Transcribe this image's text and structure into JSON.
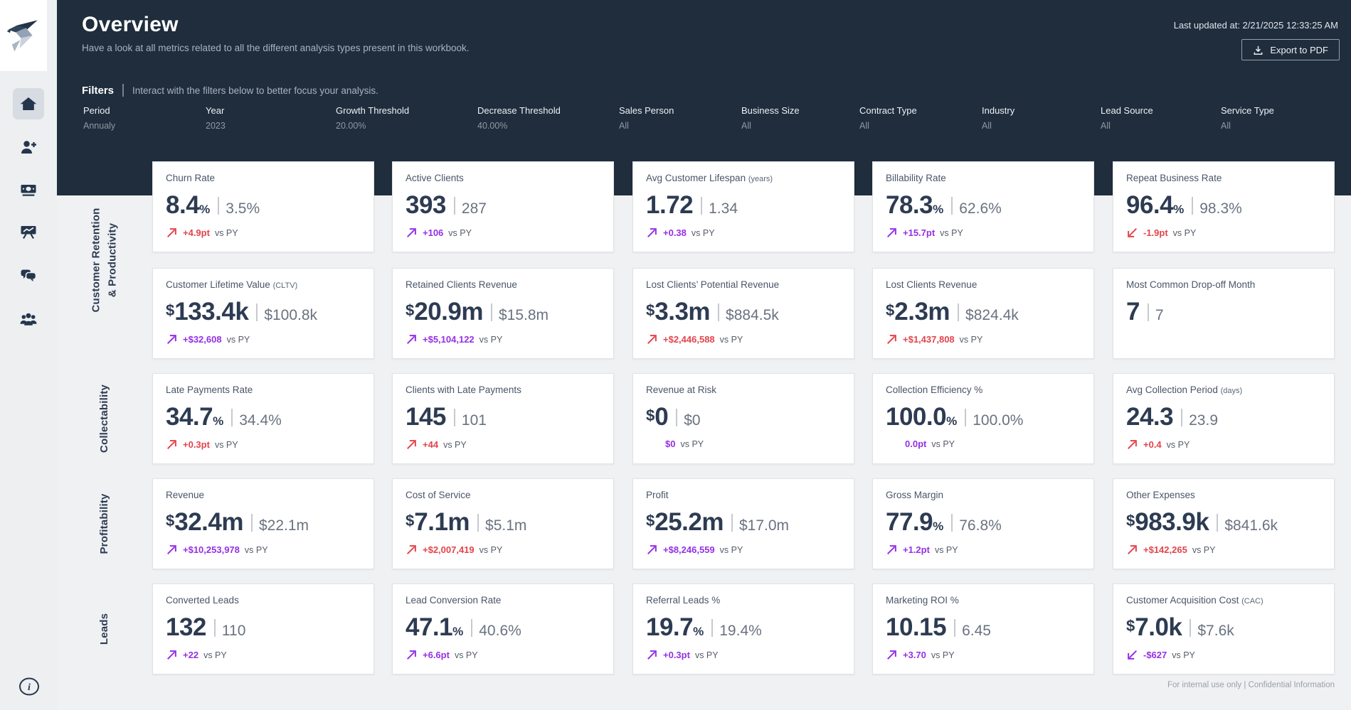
{
  "header": {
    "title": "Overview",
    "subtitle": "Have a look at all metrics related to all the different analysis types present in this workbook.",
    "last_updated": "Last updated at: 2/21/2025 12:33:25 AM",
    "export_label": "Export to PDF"
  },
  "filters": {
    "title": "Filters",
    "hint": "Interact with the filters below to better focus your analysis.",
    "items": [
      {
        "label": "Period",
        "value": "Annualy"
      },
      {
        "label": "Year",
        "value": "2023"
      },
      {
        "label": "Growth Threshold",
        "value": "20.00%"
      },
      {
        "label": "Decrease Threshold",
        "value": "40.00%"
      },
      {
        "label": "Sales Person",
        "value": "All"
      },
      {
        "label": "Business Size",
        "value": "All"
      },
      {
        "label": "Contract Type",
        "value": "All"
      },
      {
        "label": "Industry",
        "value": "All"
      },
      {
        "label": "Lead Source",
        "value": "All"
      },
      {
        "label": "Service Type",
        "value": "All"
      }
    ]
  },
  "sidebar": {
    "icons": [
      "home-icon",
      "person-add-icon",
      "cash-icon",
      "presentation-chart-icon",
      "chat-bubbles-icon",
      "people-group-icon"
    ],
    "info_icon": "info-icon",
    "logo": "bird-logo"
  },
  "colors": {
    "red": "#e2444b",
    "purple": "#9430e4",
    "header_bg": "#1f2d3c",
    "value_navy": "#2d3b52"
  },
  "vs_label": "vs PY",
  "groups": [
    {
      "label_lines": [
        "Customer Retention",
        "& Productivity"
      ],
      "cards": [
        {
          "title": "Churn Rate",
          "title_suffix": "",
          "prefix": "",
          "value": "8.4",
          "suffix": "%",
          "prev": "3.5%",
          "change": {
            "text": "+4.9pt",
            "direction": "up",
            "color": "red"
          }
        },
        {
          "title": "Active Clients",
          "title_suffix": "",
          "prefix": "",
          "value": "393",
          "suffix": "",
          "prev": "287",
          "change": {
            "text": "+106",
            "direction": "up",
            "color": "purple"
          }
        },
        {
          "title": "Avg Customer Lifespan",
          "title_suffix": "(years)",
          "prefix": "",
          "value": "1.72",
          "suffix": "",
          "prev": "1.34",
          "change": {
            "text": "+0.38",
            "direction": "up",
            "color": "purple"
          }
        },
        {
          "title": "Billability Rate",
          "title_suffix": "",
          "prefix": "",
          "value": "78.3",
          "suffix": "%",
          "prev": "62.6%",
          "change": {
            "text": "+15.7pt",
            "direction": "up",
            "color": "purple"
          }
        },
        {
          "title": "Repeat Business Rate",
          "title_suffix": "",
          "prefix": "",
          "value": "96.4",
          "suffix": "%",
          "prev": "98.3%",
          "change": {
            "text": "-1.9pt",
            "direction": "down",
            "color": "red"
          }
        },
        {
          "title": "Customer Lifetime Value",
          "title_suffix": "(CLTV)",
          "prefix": "$",
          "value": "133.4k",
          "suffix": "",
          "prev": "$100.8k",
          "change": {
            "text": "+$32,608",
            "direction": "up",
            "color": "purple"
          }
        },
        {
          "title": "Retained Clients Revenue",
          "title_suffix": "",
          "prefix": "$",
          "value": "20.9m",
          "suffix": "",
          "prev": "$15.8m",
          "change": {
            "text": "+$5,104,122",
            "direction": "up",
            "color": "purple"
          }
        },
        {
          "title": "Lost Clients’ Potential Revenue",
          "title_suffix": "",
          "prefix": "$",
          "value": "3.3m",
          "suffix": "",
          "prev": "$884.5k",
          "change": {
            "text": "+$2,446,588",
            "direction": "up",
            "color": "red"
          }
        },
        {
          "title": "Lost Clients Revenue",
          "title_suffix": "",
          "prefix": "$",
          "value": "2.3m",
          "suffix": "",
          "prev": "$824.4k",
          "change": {
            "text": "+$1,437,808",
            "direction": "up",
            "color": "red"
          }
        },
        {
          "title": "Most Common Drop-off Month",
          "title_suffix": "",
          "prefix": "",
          "value": "7",
          "suffix": "",
          "prev": "7",
          "change": null
        }
      ]
    },
    {
      "label_lines": [
        "Collectability"
      ],
      "cards": [
        {
          "title": "Late Payments Rate",
          "title_suffix": "",
          "prefix": "",
          "value": "34.7",
          "suffix": "%",
          "prev": "34.4%",
          "change": {
            "text": "+0.3pt",
            "direction": "up",
            "color": "red"
          }
        },
        {
          "title": "Clients with Late Payments",
          "title_suffix": "",
          "prefix": "",
          "value": "145",
          "suffix": "",
          "prev": "101",
          "change": {
            "text": "+44",
            "direction": "up",
            "color": "red"
          }
        },
        {
          "title": "Revenue at Risk",
          "title_suffix": "",
          "prefix": "$",
          "value": "0",
          "suffix": "",
          "prev": "$0",
          "change": {
            "text": "$0",
            "direction": "flat",
            "color": "purple"
          }
        },
        {
          "title": "Collection Efficiency %",
          "title_suffix": "",
          "prefix": "",
          "value": "100.0",
          "suffix": "%",
          "prev": "100.0%",
          "change": {
            "text": "0.0pt",
            "direction": "flat",
            "color": "purple"
          }
        },
        {
          "title": "Avg Collection Period",
          "title_suffix": "(days)",
          "prefix": "",
          "value": "24.3",
          "suffix": "",
          "prev": "23.9",
          "change": {
            "text": "+0.4",
            "direction": "up",
            "color": "red"
          }
        }
      ]
    },
    {
      "label_lines": [
        "Profitability"
      ],
      "cards": [
        {
          "title": "Revenue",
          "title_suffix": "",
          "prefix": "$",
          "value": "32.4m",
          "suffix": "",
          "prev": "$22.1m",
          "change": {
            "text": "+$10,253,978",
            "direction": "up",
            "color": "purple"
          }
        },
        {
          "title": "Cost of Service",
          "title_suffix": "",
          "prefix": "$",
          "value": "7.1m",
          "suffix": "",
          "prev": "$5.1m",
          "change": {
            "text": "+$2,007,419",
            "direction": "up",
            "color": "red"
          }
        },
        {
          "title": "Profit",
          "title_suffix": "",
          "prefix": "$",
          "value": "25.2m",
          "suffix": "",
          "prev": "$17.0m",
          "change": {
            "text": "+$8,246,559",
            "direction": "up",
            "color": "purple"
          }
        },
        {
          "title": "Gross Margin",
          "title_suffix": "",
          "prefix": "",
          "value": "77.9",
          "suffix": "%",
          "prev": "76.8%",
          "change": {
            "text": "+1.2pt",
            "direction": "up",
            "color": "purple"
          }
        },
        {
          "title": "Other Expenses",
          "title_suffix": "",
          "prefix": "$",
          "value": "983.9k",
          "suffix": "",
          "prev": "$841.6k",
          "change": {
            "text": "+$142,265",
            "direction": "up",
            "color": "red"
          }
        }
      ]
    },
    {
      "label_lines": [
        "Leads"
      ],
      "cards": [
        {
          "title": "Converted Leads",
          "title_suffix": "",
          "prefix": "",
          "value": "132",
          "suffix": "",
          "prev": "110",
          "change": {
            "text": "+22",
            "direction": "up",
            "color": "purple"
          }
        },
        {
          "title": "Lead Conversion Rate",
          "title_suffix": "",
          "prefix": "",
          "value": "47.1",
          "suffix": "%",
          "prev": "40.6%",
          "change": {
            "text": "+6.6pt",
            "direction": "up",
            "color": "purple"
          }
        },
        {
          "title": "Referral Leads %",
          "title_suffix": "",
          "prefix": "",
          "value": "19.7",
          "suffix": "%",
          "prev": "19.4%",
          "change": {
            "text": "+0.3pt",
            "direction": "up",
            "color": "purple"
          }
        },
        {
          "title": "Marketing ROI %",
          "title_suffix": "",
          "prefix": "",
          "value": "10.15",
          "suffix": "",
          "prev": "6.45",
          "change": {
            "text": "+3.70",
            "direction": "up",
            "color": "purple"
          }
        },
        {
          "title": "Customer Acquisition Cost",
          "title_suffix": "(CAC)",
          "prefix": "$",
          "value": "7.0k",
          "suffix": "",
          "prev": "$7.6k",
          "change": {
            "text": "-$627",
            "direction": "down",
            "color": "purple"
          }
        }
      ]
    }
  ],
  "footer": "For internal use only  |  Confidential Information"
}
